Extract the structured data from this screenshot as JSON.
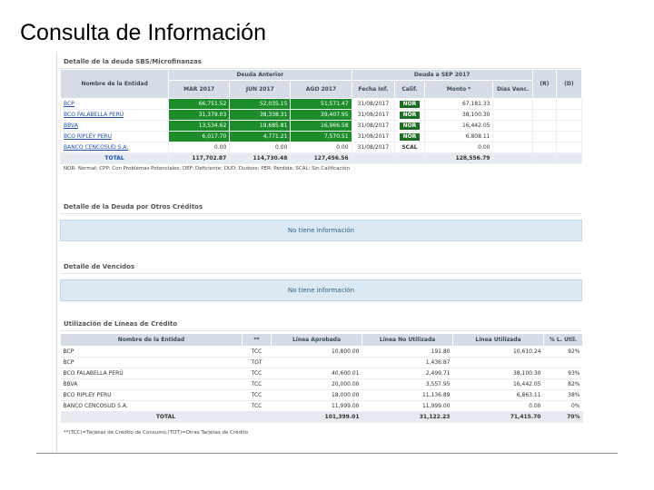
{
  "slide_title": "Consulta de Información",
  "deuda_sbs": {
    "title": "Detalle de la deuda SBS/Microfinanzas",
    "group_headers": {
      "deuda_anterior": "Deuda Anterior",
      "deuda_actual": "Deuda a SEP 2017"
    },
    "columns": {
      "entity": "Nombre de la Entidad",
      "mar": "MAR 2017",
      "jun": "JUN 2017",
      "ago": "AGO 2017",
      "fecha": "Fecha Inf.",
      "calif": "Calif.",
      "monto": "Monto *",
      "dias": "Días Venc.",
      "r": "(R)",
      "d": "(D)"
    },
    "rows": [
      {
        "entity": "BCP",
        "mar": "66,751.52",
        "jun": "52,035.15",
        "ago": "51,571.47",
        "fecha": "31/08/2017",
        "calif": "NOR",
        "monto": "67,181.33"
      },
      {
        "entity": "BCO FALABELLA PERÚ",
        "mar": "31,379.03",
        "jun": "38,338.31",
        "ago": "39,407.95",
        "fecha": "31/08/2017",
        "calif": "NOR",
        "monto": "38,100.30"
      },
      {
        "entity": "BBVA",
        "mar": "13,534.62",
        "jun": "19,685.81",
        "ago": "16,966.58",
        "fecha": "31/08/2017",
        "calif": "NOR",
        "monto": "16,442.05"
      },
      {
        "entity": "BCO RIPLEY PERU",
        "mar": "6,017.70",
        "jun": "4,771.21",
        "ago": "7,570.51",
        "fecha": "31/08/2017",
        "calif": "NOR",
        "monto": "6,808.11"
      },
      {
        "entity": "BANCO CENCOSUD S.A.",
        "mar": "0.00",
        "jun": "0.00",
        "ago": "0.00",
        "fecha": "31/08/2017",
        "calif": "SCAL",
        "monto": "0.00"
      }
    ],
    "total": {
      "label": "TOTAL",
      "mar": "117,702.87",
      "jun": "114,730.48",
      "ago": "127,456.56",
      "monto": "128,556.79"
    },
    "legend": "NOR: Normal; CPP: Con Problemas Potenciales; DEF: Deficiente; DUD: Dudoso; PER: Pérdida; SCAL: Sin Calificación"
  },
  "otros_creditos": {
    "title": "Detalle de la Deuda por Otros Créditos",
    "message": "No tiene información"
  },
  "vencidos": {
    "title": "Detalle de Vencidos",
    "message": "No tiene información"
  },
  "lineas": {
    "title": "Utilización de Líneas de Crédito",
    "columns": {
      "entity": "Nombre de la Entidad",
      "tipo": "**",
      "aprobada": "Línea Aprobada",
      "no_utilizada": "Línea No Utilizada",
      "utilizada": "Línea Utilizada",
      "pct": "% L. Util."
    },
    "rows": [
      {
        "entity": "BCP",
        "tipo": "TCC",
        "aprobada": "10,800.00",
        "no_utilizada": "191.80",
        "utilizada": "10,610.24",
        "pct": "92%"
      },
      {
        "entity": "BCP",
        "tipo": "TOT",
        "aprobada": "",
        "no_utilizada": "1,436.87",
        "utilizada": "",
        "pct": ""
      },
      {
        "entity": "BCO FALABELLA PERÚ",
        "tipo": "TCC",
        "aprobada": "40,600.01",
        "no_utilizada": "2,499.71",
        "utilizada": "38,100.30",
        "pct": "93%"
      },
      {
        "entity": "BBVA",
        "tipo": "TCC",
        "aprobada": "20,000.00",
        "no_utilizada": "3,557.95",
        "utilizada": "16,442.05",
        "pct": "82%"
      },
      {
        "entity": "BCO RIPLEY PERU",
        "tipo": "TCC",
        "aprobada": "18,000.00",
        "no_utilizada": "11,136.89",
        "utilizada": "6,863.11",
        "pct": "38%"
      },
      {
        "entity": "BANCO CENCOSUD S.A.",
        "tipo": "TCC",
        "aprobada": "11,999.00",
        "no_utilizada": "11,999.00",
        "utilizada": "0.00",
        "pct": "0%"
      }
    ],
    "total": {
      "label": "TOTAL",
      "aprobada": "101,399.01",
      "no_utilizada": "31,122.23",
      "utilizada": "71,415.70",
      "pct": "70%"
    },
    "footnote": "**(TCC)=Tarjetas de Crédito de Consumo,(TOT)=Otras Tarjetas de Crédito"
  }
}
